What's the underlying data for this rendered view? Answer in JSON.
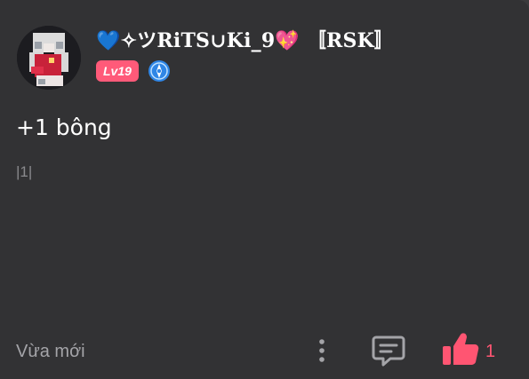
{
  "post": {
    "author": {
      "name": "💙✧ツRiTS∪Ki_9💖 〚RSK〛",
      "level": "Lv19",
      "badge_icon": "achievement-badge-icon"
    },
    "content": "+1 bông",
    "marker": "|1|",
    "timestamp": "Vừa mới",
    "likes": "1"
  },
  "colors": {
    "background": "#323234",
    "level_badge": "#ff5a79",
    "like": "#ff5572",
    "badge_blue": "#2f86e6"
  },
  "icons": [
    "more-options-icon",
    "comment-icon",
    "like-icon"
  ]
}
